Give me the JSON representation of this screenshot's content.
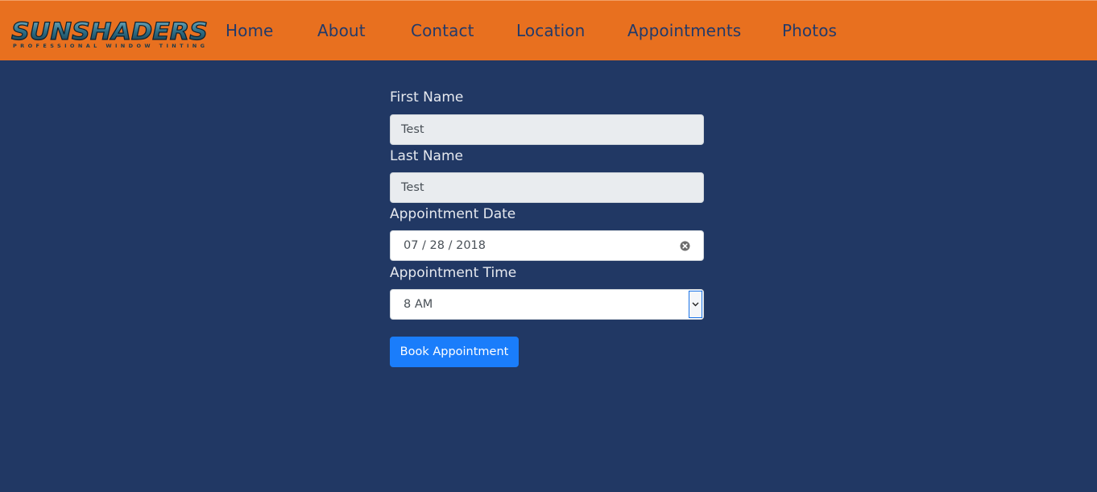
{
  "brand": {
    "logo_text": "SUNSHADERS",
    "logo_tagline": "PROFESSIONAL WINDOW TINTING",
    "nav_color": "#e8701f",
    "background_color": "#213864"
  },
  "nav": {
    "items": [
      "Home",
      "About",
      "Contact",
      "Location",
      "Appointments",
      "Photos"
    ]
  },
  "form": {
    "first_name": {
      "label": "First Name",
      "value": "Test"
    },
    "last_name": {
      "label": "Last Name",
      "value": "Test"
    },
    "date": {
      "label": "Appointment Date",
      "value": "07 / 28 / 2018",
      "clear_icon": "clear-icon"
    },
    "time": {
      "label": "Appointment Time",
      "value": "8 AM",
      "arrow_icon": "chevron-down-icon"
    },
    "submit_label": "Book Appointment"
  }
}
